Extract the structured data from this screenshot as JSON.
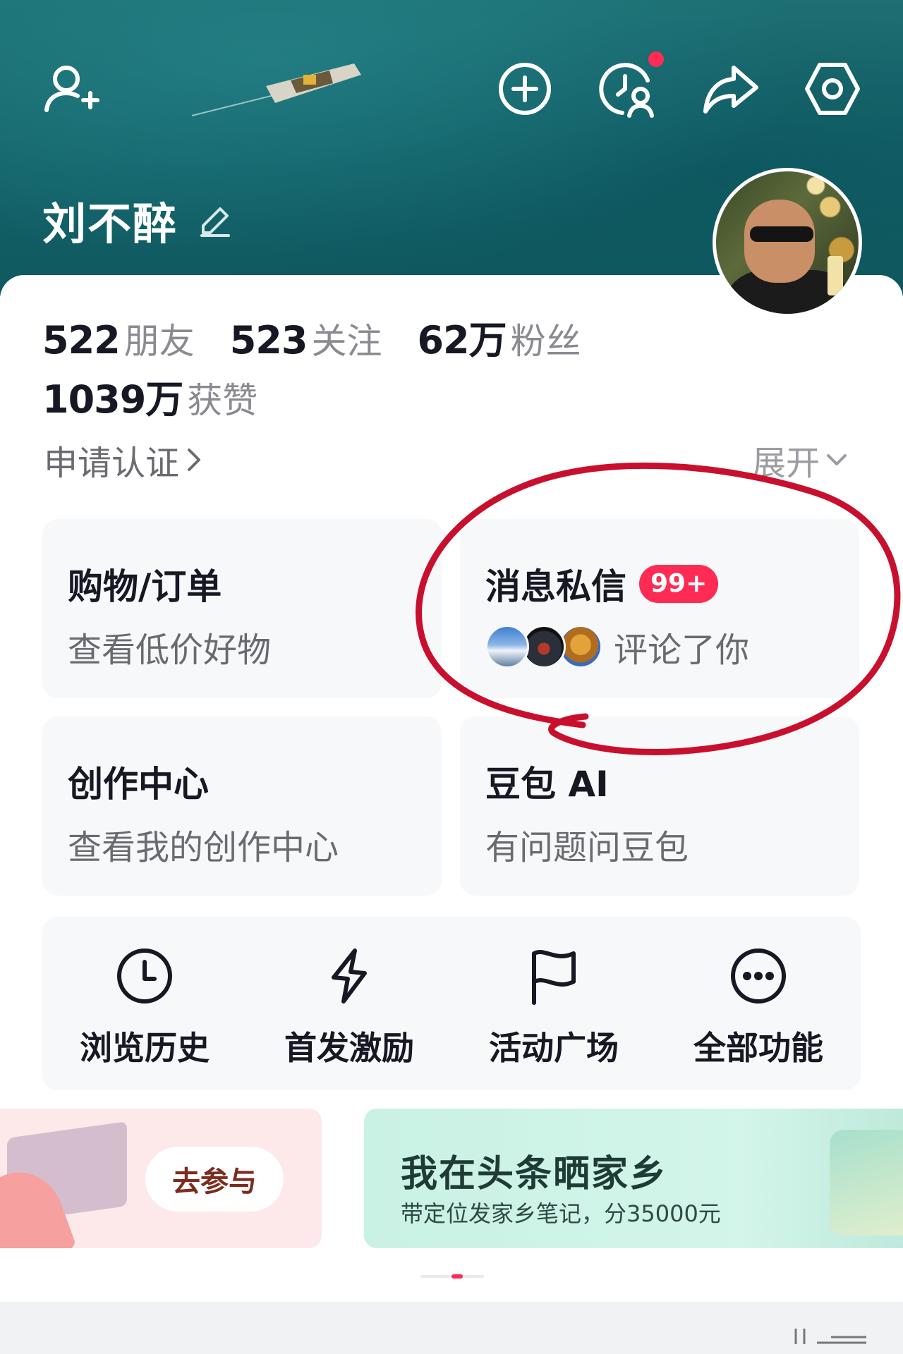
{
  "header": {
    "username": "刘不醉",
    "icons": [
      "add-friend-icon",
      "add-icon",
      "visitor-history-icon",
      "share-icon",
      "settings-icon"
    ],
    "notification_dot_color": "#fe2c55"
  },
  "stats": {
    "friends": {
      "value": "522",
      "label": "朋友"
    },
    "following": {
      "value": "523",
      "label": "关注"
    },
    "fans": {
      "value": "62万",
      "label": "粉丝"
    },
    "likes": {
      "value": "1039万",
      "label": "获赞"
    }
  },
  "verify": {
    "label": "申请认证"
  },
  "expand": {
    "label": "展开"
  },
  "cards": {
    "shopping": {
      "title": "购物/订单",
      "subtitle": "查看低价好物"
    },
    "messages": {
      "title": "消息私信",
      "badge": "99+",
      "subtitle": "评论了你"
    },
    "creator": {
      "title": "创作中心",
      "subtitle": "查看我的创作中心"
    },
    "doubao": {
      "title": "豆包 AI",
      "subtitle": "有问题问豆包"
    }
  },
  "tools": [
    {
      "label": "浏览历史",
      "icon": "clock-icon"
    },
    {
      "label": "首发激励",
      "icon": "lightning-icon"
    },
    {
      "label": "活动广场",
      "icon": "flag-icon"
    },
    {
      "label": "全部功能",
      "icon": "more-icon"
    }
  ],
  "banners": {
    "left": {
      "button": "去参与"
    },
    "right": {
      "title": "我在头条晒家乡",
      "subtitle": "带定位发家乡笔记，分35000元"
    }
  },
  "colors": {
    "accent": "#fe2c55",
    "header_bg": "#176a6f",
    "card_bg": "#f7f8fa",
    "annotation_red": "#c8102e"
  }
}
